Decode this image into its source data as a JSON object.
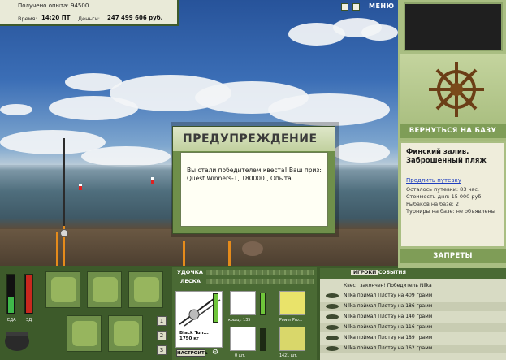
{
  "header": {
    "xp_label": "Получено опыта: 94500",
    "time_label": "Время:",
    "time_value": "14:20 ПТ",
    "money_label": "Деньги:",
    "money_value": "247 499 606 руб.",
    "menu_label": "МЕНЮ",
    "icon_buttons": [
      "pause-icon",
      "sound-icon"
    ]
  },
  "dialog": {
    "title": "ПРЕДУПРЕЖДЕНИЕ",
    "message": "Вы стали победителем квеста! Ваш приз: Quest Winners-1, 180000 , Опыта"
  },
  "sidebar": {
    "return_button": "ВЕРНУТЬСЯ НА БАЗУ",
    "location_title": "Финский залив. Заброшенный пляж",
    "extend_link": "Продлить путевку",
    "days_left": "Осталось путевки: 83 час.",
    "day_cost": "Стоимость дня: 15 000 руб.",
    "fishers": "Рыбаков на базе: 2",
    "tournaments": "Турниры на базе: не объявлены",
    "bans_button": "ЗАПРЕТЫ"
  },
  "gauges": {
    "food_label": "ЕДА",
    "food_level": 0.42,
    "food_color": "#3fb84a",
    "health_label": "ЗД",
    "health_level": 0.95,
    "health_color": "#c8281e"
  },
  "tackle": {
    "rod_label": "УДОЧКА",
    "line_label": "ЛЕСКА",
    "rod_name": "Black Tun...",
    "rod_weight": "1750 кг",
    "condition": "98%",
    "condition_level": 0.98,
    "setup_button": "НАСТРОИТЬ",
    "items": [
      {
        "caption": "кошц.: 135",
        "count": "100%"
      },
      {
        "caption": "Power Pro...",
        "count": ""
      },
      {
        "caption": "0 шт.",
        "count": ""
      },
      {
        "caption": "1421 шт.",
        "count": ""
      }
    ],
    "slot_numbers": [
      "1",
      "2",
      "3"
    ]
  },
  "log": {
    "tabs": [
      "ИГРОКИ",
      "СОБЫТИЯ"
    ],
    "quest_line": "Квест закончен! Победитель Nilka",
    "entries": [
      "Nilka поймал Плотву на 409 грамм",
      "Nilka поймал Плотву на 186 грамм",
      "Nilka поймал Плотву на 140 грамм",
      "Nilka поймал Плотву на 116 грамм",
      "Nilka поймал Плотву на 189 грамм",
      "Nilka поймал Плотву на 162 грамм"
    ]
  }
}
